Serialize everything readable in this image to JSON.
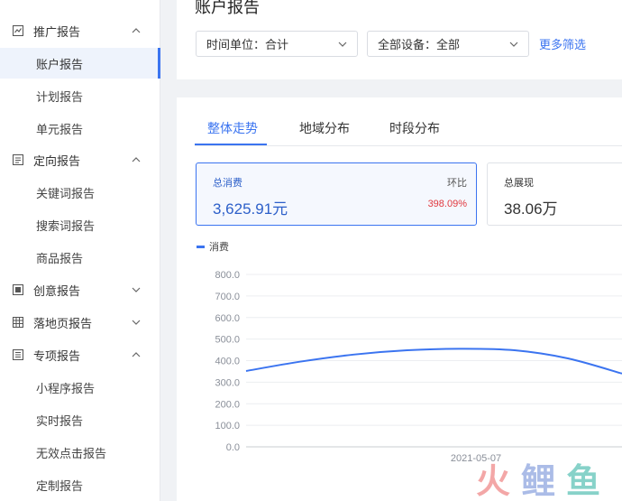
{
  "sidebar": {
    "items": [
      {
        "label": "推广报告",
        "type": "group",
        "icon": "line-chart-icon",
        "chevron": "up",
        "y": 17
      },
      {
        "label": "账户报告",
        "type": "sub",
        "active": true,
        "y": 53
      },
      {
        "label": "计划报告",
        "type": "sub",
        "y": 89
      },
      {
        "label": "单元报告",
        "type": "sub",
        "y": 125
      },
      {
        "label": "定向报告",
        "type": "group",
        "icon": "target-doc-icon",
        "chevron": "up",
        "y": 160
      },
      {
        "label": "关键词报告",
        "type": "sub",
        "y": 196
      },
      {
        "label": "搜索词报告",
        "type": "sub",
        "y": 232
      },
      {
        "label": "商品报告",
        "type": "sub",
        "y": 268
      },
      {
        "label": "创意报告",
        "type": "group",
        "icon": "creative-icon",
        "chevron": "down",
        "y": 304
      },
      {
        "label": "落地页报告",
        "type": "group",
        "icon": "grid-icon",
        "chevron": "down",
        "y": 340
      },
      {
        "label": "专项报告",
        "type": "group",
        "icon": "list-doc-icon",
        "chevron": "up",
        "y": 376
      },
      {
        "label": "小程序报告",
        "type": "sub",
        "y": 412
      },
      {
        "label": "实时报告",
        "type": "sub",
        "y": 448
      },
      {
        "label": "无效点击报告",
        "type": "sub",
        "y": 484
      },
      {
        "label": "定制报告",
        "type": "sub",
        "y": 520
      }
    ]
  },
  "header": {
    "title": "账户报告",
    "time_unit_select": "时间单位：合计",
    "device_select": "全部设备：全部",
    "more_filter": "更多筛选"
  },
  "tabs": [
    "整体走势",
    "地域分布",
    "时段分布"
  ],
  "cards": {
    "spend": {
      "title": "总消费",
      "value": "3,625.91元",
      "hb_label": "环比",
      "hb_value": "398.09%"
    },
    "impressions": {
      "title": "总展现",
      "value": "38.06万"
    }
  },
  "chart_data": {
    "type": "line",
    "legend": [
      "消费"
    ],
    "y_ticks": [
      "800.0",
      "700.0",
      "600.0",
      "500.0",
      "400.0",
      "300.0",
      "200.0",
      "100.0",
      "0.0"
    ],
    "ylim": [
      0,
      800
    ],
    "x_tick": "2021-05-07",
    "series": [
      {
        "name": "消费",
        "color": "#3b74f0",
        "values": [
          352,
          395,
          428,
          448,
          455,
          448,
          410,
          340
        ]
      }
    ]
  },
  "watermark": "火鲤鱼",
  "colors": {
    "accent": "#3b74f0",
    "danger": "#e0383e"
  }
}
